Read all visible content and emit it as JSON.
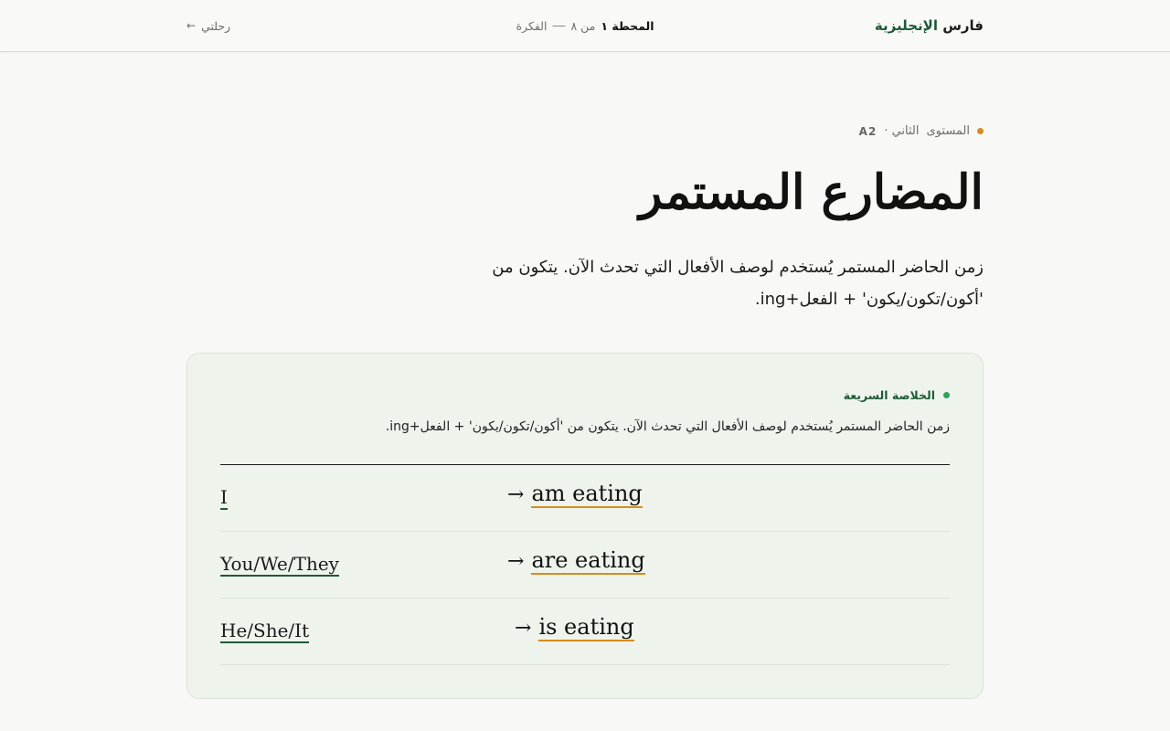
{
  "header": {
    "brand_prefix": "فارس ",
    "brand_accent": "الإنجليزية",
    "station_label": "المحطة ١",
    "station_of": "من ٨",
    "section": "الفكرة",
    "back_label": "رحلتي",
    "back_icon": "arrow-left-icon"
  },
  "lesson": {
    "level_label": "المستوى",
    "level_name": "الثاني ·",
    "level_code": "A2",
    "title": "المضارع المستمر",
    "description": "زمن الحاضر المستمر يُستخدم لوصف الأفعال التي تحدث الآن. يتكون من 'أكون/تكون/يكون' + الفعل+ing."
  },
  "summary": {
    "label": "الخلاصة السريعة",
    "text": "زمن الحاضر المستمر يُستخدم لوصف الأفعال التي تحدث الآن. يتكون من 'أكون/تكون/يكون' + الفعل+ing.",
    "rows": [
      {
        "subject": "I",
        "arrow": "→",
        "verb": "am eating"
      },
      {
        "subject": "You/We/They",
        "arrow": "→",
        "verb": "are eating"
      },
      {
        "subject": "He/She/It",
        "arrow": "→",
        "verb": "is eating"
      }
    ]
  },
  "colors": {
    "brand_green": "#1e5a36",
    "accent_orange": "#d98b1e",
    "card_bg": "#eef4ec",
    "dot_green": "#2fa257"
  }
}
